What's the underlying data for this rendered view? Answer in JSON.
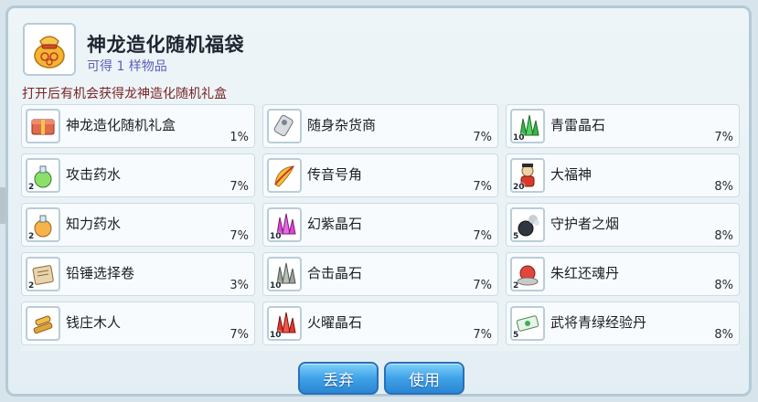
{
  "header": {
    "title": "神龙造化随机福袋",
    "subtitle": "可得 1 样物品",
    "icon": "lucky-bag-icon"
  },
  "description": "打开后有机会获得龙神造化随机礼盒",
  "items": [
    {
      "name": "神龙造化随机礼盒",
      "pct": "1%",
      "count": "",
      "icon": "gift-box-icon"
    },
    {
      "name": "随身杂货商",
      "pct": "7%",
      "count": "",
      "icon": "merchant-icon"
    },
    {
      "name": "青雷晶石",
      "pct": "7%",
      "count": "10",
      "icon": "green-crystal-icon"
    },
    {
      "name": "攻击药水",
      "pct": "7%",
      "count": "2",
      "icon": "attack-potion-icon"
    },
    {
      "name": "传音号角",
      "pct": "7%",
      "count": "",
      "icon": "horn-icon"
    },
    {
      "name": "大福神",
      "pct": "8%",
      "count": "20",
      "icon": "fortune-god-icon"
    },
    {
      "name": "知力药水",
      "pct": "7%",
      "count": "2",
      "icon": "int-potion-icon"
    },
    {
      "name": "幻紫晶石",
      "pct": "7%",
      "count": "10",
      "icon": "purple-crystal-icon"
    },
    {
      "name": "守护者之烟",
      "pct": "8%",
      "count": "5",
      "icon": "smoke-bomb-icon"
    },
    {
      "name": "铅锤选择卷",
      "pct": "3%",
      "count": "2",
      "icon": "scroll-icon"
    },
    {
      "name": "合击晶石",
      "pct": "7%",
      "count": "10",
      "icon": "gray-crystal-icon"
    },
    {
      "name": "朱红还魂丹",
      "pct": "8%",
      "count": "2",
      "icon": "red-pill-icon"
    },
    {
      "name": "钱庄木人",
      "pct": "7%",
      "count": "",
      "icon": "wooden-dummy-icon"
    },
    {
      "name": "火曜晶石",
      "pct": "7%",
      "count": "10",
      "icon": "red-crystal-icon"
    },
    {
      "name": "武将青绿经验丹",
      "pct": "8%",
      "count": "5",
      "icon": "exp-pill-icon"
    }
  ],
  "buttons": {
    "discard": "丢弃",
    "use": "使用"
  }
}
